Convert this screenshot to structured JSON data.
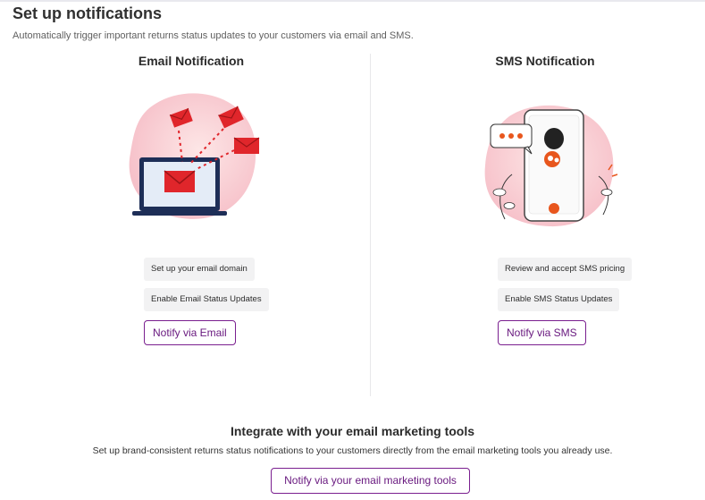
{
  "header": {
    "title": "Set up notifications",
    "subtitle": "Automatically trigger important returns status updates to your customers via email and SMS."
  },
  "email": {
    "title": "Email Notification",
    "steps": [
      "Set up your email domain",
      "Enable Email Status Updates"
    ],
    "button_label": "Notify via Email"
  },
  "sms": {
    "title": "SMS Notification",
    "steps": [
      "Review and accept SMS pricing",
      "Enable SMS Status Updates"
    ],
    "button_label": "Notify via SMS"
  },
  "integrate": {
    "title": "Integrate with your email marketing tools",
    "text": "Set up brand-consistent returns status notifications to your customers directly from the email marketing tools you already use.",
    "button_label": "Notify via your email marketing tools"
  },
  "colors": {
    "accent": "#7a1f8f",
    "email_red": "#e0262b",
    "blob_pink": "#f7c9cf"
  }
}
